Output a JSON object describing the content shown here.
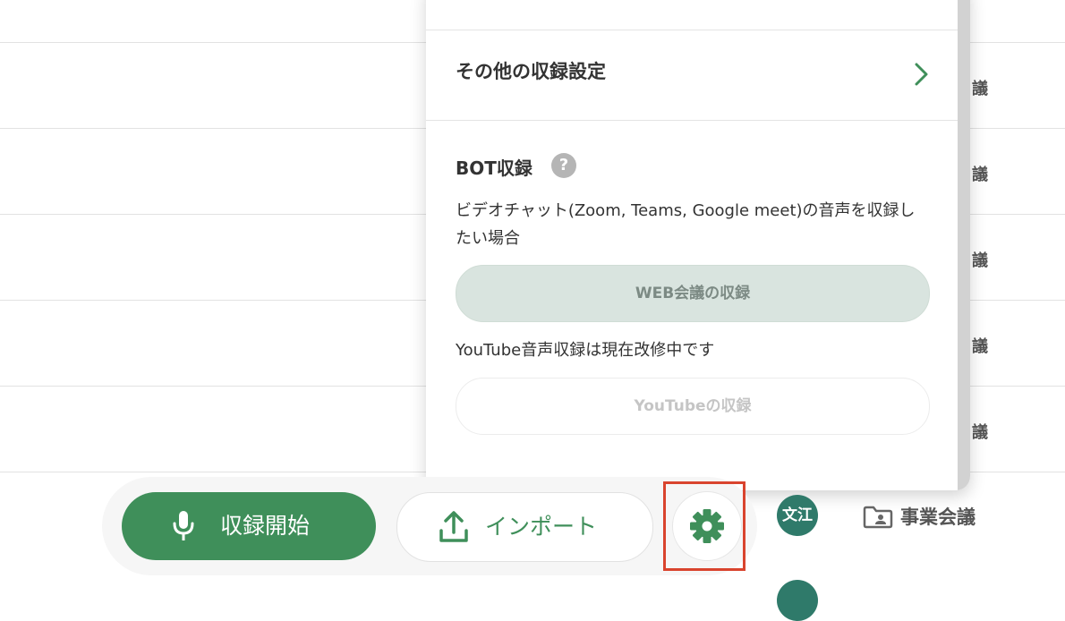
{
  "background_rows": [
    {
      "tag": "議"
    },
    {
      "tag": "議"
    },
    {
      "tag": "議"
    },
    {
      "tag": "議"
    },
    {
      "tag": "議"
    }
  ],
  "panel": {
    "other_settings_label": "その他の収録設定",
    "bot_title": "BOT収録",
    "help_icon": "?",
    "bot_description": "ビデオチャット(Zoom, Teams, Google meet)の音声を収録したい場合",
    "web_button_label": "WEB会議の収録",
    "youtube_note": "YouTube音声収録は現在改修中です",
    "youtube_button_label": "YouTubeの収録"
  },
  "bottom_bar": {
    "record_label": "収録開始",
    "import_label": "インポート"
  },
  "list_item": {
    "avatar_text": "文江",
    "folder_label": "事業会議"
  },
  "colors": {
    "accent": "#3f8f5a",
    "highlight": "#d9442e",
    "avatar": "#2f7a6a"
  },
  "icons": {
    "record": "mic-icon",
    "import": "upload-icon",
    "settings": "gear-icon",
    "chevron": "chevron-right-icon",
    "folder": "folder-icon"
  }
}
